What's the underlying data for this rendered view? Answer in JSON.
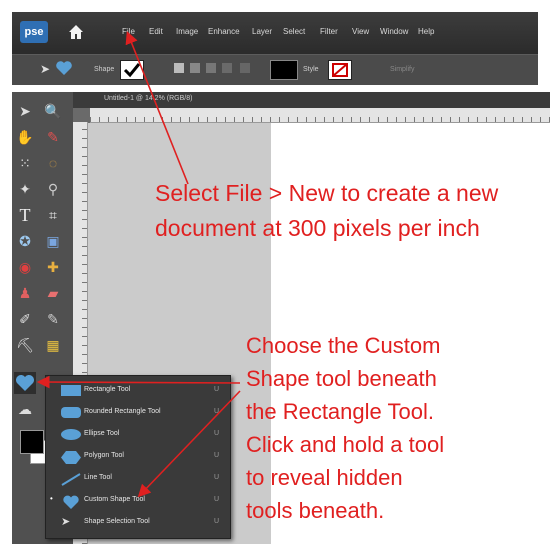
{
  "app": {
    "logo": "pse",
    "home_icon": "home-icon"
  },
  "menu": [
    "File",
    "Edit",
    "Image",
    "Enhance",
    "Layer",
    "Select",
    "Filter",
    "View",
    "Window",
    "Help"
  ],
  "options_bar": {
    "shape_label": "Shape",
    "style_label": "Style",
    "simplify_label": "Simplify"
  },
  "document": {
    "tab_title": "Untitled-1 @ 14.2% (RGB/8)"
  },
  "flyout": {
    "items": [
      {
        "label": "Rectangle Tool",
        "key": "U",
        "icon": "rectangle-icon"
      },
      {
        "label": "Rounded Rectangle Tool",
        "key": "U",
        "icon": "rounded-rectangle-icon"
      },
      {
        "label": "Ellipse Tool",
        "key": "U",
        "icon": "ellipse-icon"
      },
      {
        "label": "Polygon Tool",
        "key": "U",
        "icon": "polygon-icon"
      },
      {
        "label": "Line Tool",
        "key": "U",
        "icon": "line-icon"
      },
      {
        "label": "Custom Shape Tool",
        "key": "U",
        "icon": "heart-icon",
        "selected": true
      },
      {
        "label": "Shape Selection Tool",
        "key": "U",
        "icon": "arrow-icon"
      }
    ]
  },
  "annotations": {
    "note1_line1": "Select File > New to create a new",
    "note1_line2": "document at 300 pixels per inch",
    "note2_lines": [
      "Choose the Custom",
      "Shape tool beneath",
      "the Rectangle Tool.",
      "Click and hold a tool",
      "to reveal hidden",
      "tools beneath."
    ]
  },
  "colors": {
    "annotation": "#e02020",
    "accent": "#5aa0d6",
    "menubar": "#333333"
  }
}
